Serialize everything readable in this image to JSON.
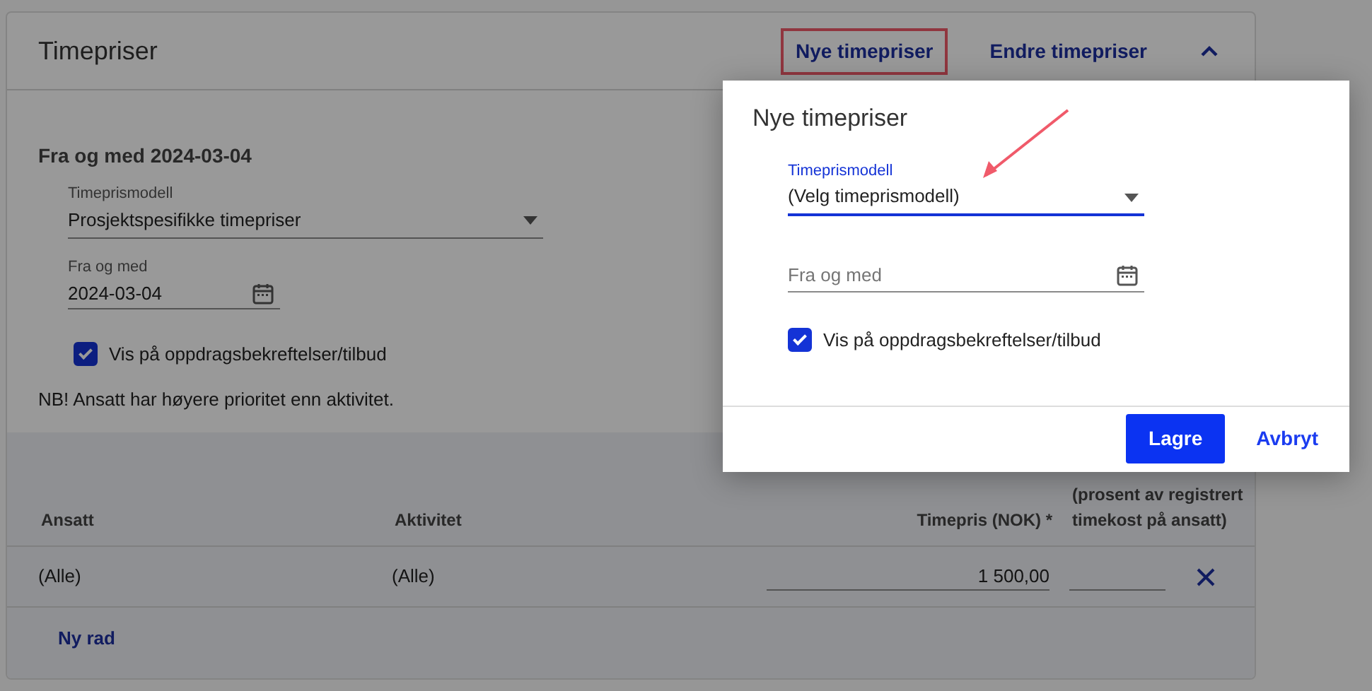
{
  "card": {
    "title": "Timepriser",
    "actions": [
      {
        "label": "Nye timepriser",
        "highlighted": true
      },
      {
        "label": "Endre timepriser",
        "highlighted": false
      }
    ],
    "expanded": true
  },
  "period": {
    "heading": "Fra og med 2024-03-04",
    "model": {
      "label": "Timeprismodell",
      "value": "Prosjektspesifikke timepriser"
    },
    "date": {
      "label": "Fra og med",
      "value": "2024-03-04"
    },
    "show_on_confirmations": {
      "label": "Vis på oppdragsbekreftelser/tilbud",
      "checked": true
    },
    "note": "NB! Ansatt har høyere prioritet enn aktivitet."
  },
  "table": {
    "columns": [
      "Ansatt",
      "Aktivitet",
      "Timepris (NOK) *",
      "(prosent av registrert timekost på ansatt)"
    ],
    "rows": [
      {
        "ansatt": "(Alle)",
        "aktivitet": "(Alle)",
        "timepris": "1 500,00"
      }
    ],
    "add_row": "Ny rad"
  },
  "dialog": {
    "title": "Nye timepriser",
    "model": {
      "label": "Timeprismodell",
      "value": "(Velg timeprismodell)",
      "focused": true,
      "pointed_at": true
    },
    "date": {
      "placeholder": "Fra og med"
    },
    "show_on_confirmations": {
      "label": "Vis på oppdragsbekreftelser/tilbud",
      "checked": true
    },
    "buttons": [
      {
        "label": "Lagre",
        "kind": "primary"
      },
      {
        "label": "Avbryt",
        "kind": "link"
      }
    ]
  }
}
